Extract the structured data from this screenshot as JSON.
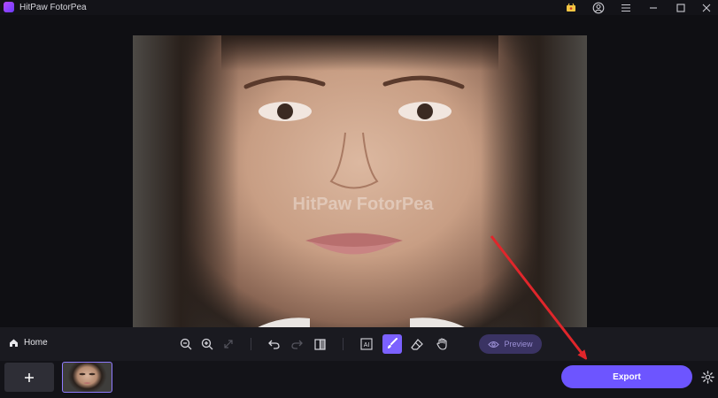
{
  "window": {
    "title": "HitPaw FotorPea"
  },
  "titlebar_icons": [
    "cart-icon",
    "account-icon",
    "menu-icon",
    "minimize-icon",
    "maximize-icon",
    "close-icon"
  ],
  "canvas": {
    "watermark": "HitPaw FotorPea"
  },
  "toolbar": {
    "home_label": "Home",
    "preview_label": "Preview",
    "tools": [
      "zoom-out-icon",
      "zoom-in-icon",
      "fit-screen-icon",
      "undo-icon",
      "redo-icon",
      "compare-icon",
      "ai-select-icon",
      "brush-icon",
      "eraser-icon",
      "hand-icon"
    ]
  },
  "bottombar": {
    "export_label": "Export"
  },
  "colors": {
    "accent": "#6d55ff",
    "annotation_arrow": "#e0262b"
  }
}
